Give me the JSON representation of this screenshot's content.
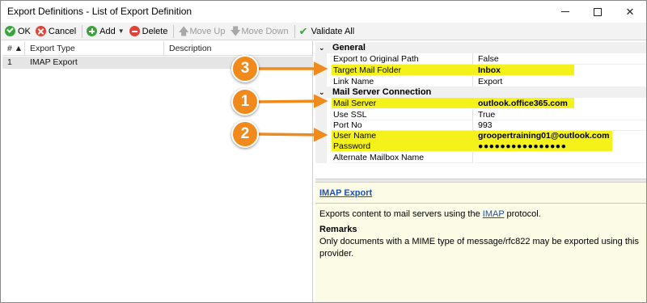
{
  "window": {
    "title": "Export Definitions - List of Export Definition",
    "minimize_icon": "minimize-icon",
    "maximize_icon": "maximize-icon",
    "close_icon": "close-icon"
  },
  "toolbar": {
    "ok": "OK",
    "cancel": "Cancel",
    "add": "Add",
    "delete": "Delete",
    "move_up": "Move Up",
    "move_down": "Move Down",
    "validate_all": "Validate All"
  },
  "list": {
    "columns": [
      "# ▲",
      "Export Type",
      "Description"
    ],
    "rows": [
      {
        "num": "1",
        "type": "IMAP Export",
        "description": ""
      }
    ]
  },
  "properties": {
    "general": {
      "label": "General",
      "rows": [
        {
          "name": "Export to Original Path",
          "value": "False"
        },
        {
          "name": "Target Mail Folder",
          "value": "Inbox",
          "highlight": true
        },
        {
          "name": "Link Name",
          "value": "Export"
        }
      ]
    },
    "mail_server": {
      "label": "Mail Server Connection",
      "rows": [
        {
          "name": "Mail Server",
          "value": "outlook.office365.com",
          "highlight": true
        },
        {
          "name": "Use SSL",
          "value": "True"
        },
        {
          "name": "Port No",
          "value": "993"
        },
        {
          "name": "User Name",
          "value": "groopertraining01@outlook.com",
          "highlight": true
        },
        {
          "name": "Password",
          "value": "●●●●●●●●●●●●●●●●",
          "highlight": true
        },
        {
          "name": "Alternate Mailbox Name",
          "value": ""
        }
      ]
    }
  },
  "help": {
    "title": "IMAP Export",
    "desc_before": "Exports content to mail servers using the ",
    "desc_link": "IMAP",
    "desc_after": " protocol.",
    "remarks_label": "Remarks",
    "remarks_text": "Only documents with a MIME type of message/rfc822 may be exported using this provider."
  },
  "callouts": [
    "3",
    "1",
    "2"
  ],
  "colors": {
    "highlight": "#f5f21b",
    "callout": "#f08a1d",
    "link": "#1b53b6",
    "help_bg": "#fbfbe6"
  }
}
